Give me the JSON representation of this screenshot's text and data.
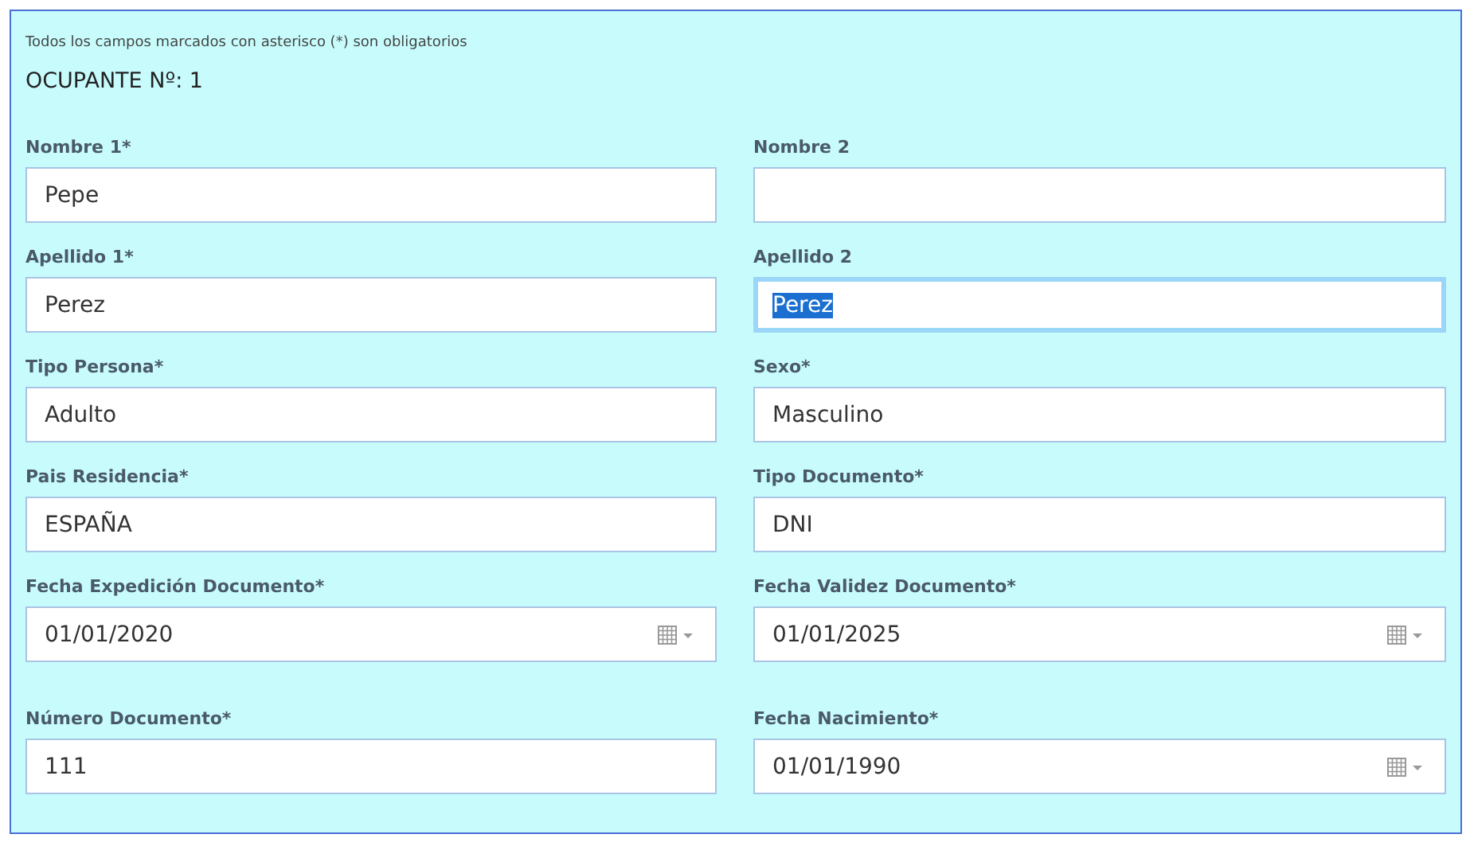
{
  "notice": "Todos los campos marcados con asterisco (*) son obligatorios",
  "heading": "OCUPANTE Nº: 1",
  "rows": [
    [
      {
        "label": "Nombre 1*",
        "kind": "text",
        "value": "Pepe",
        "focused": false
      },
      {
        "label": "Nombre 2",
        "kind": "text",
        "focused": false
      }
    ],
    [
      {
        "label": "Apellido 1*",
        "kind": "text",
        "value": "Perez",
        "focused": false
      },
      {
        "label": "Apellido 2",
        "kind": "text",
        "value": "Perez",
        "focused": true
      }
    ],
    [
      {
        "label": "Tipo Persona*",
        "kind": "text",
        "value": "Adulto",
        "focused": false
      },
      {
        "label": "Sexo*",
        "kind": "text",
        "value": "Masculino",
        "focused": false
      }
    ],
    [
      {
        "label": "Pais Residencia*",
        "kind": "text",
        "value": "ESPAÑA",
        "focused": false
      },
      {
        "label": "Tipo Documento*",
        "kind": "text",
        "value": "DNI",
        "focused": false
      }
    ],
    [
      {
        "label": "Fecha Expedición Documento*",
        "kind": "date",
        "value": "01/01/2020",
        "focused": false
      },
      {
        "label": "Fecha Validez Documento*",
        "kind": "date",
        "value": "01/01/2025",
        "focused": false
      }
    ],
    [
      {
        "label": "Número Documento*",
        "kind": "text",
        "value": "111",
        "focused": false
      },
      {
        "label": "Fecha Nacimiento*",
        "kind": "date",
        "value": "01/01/1990",
        "focused": false
      }
    ]
  ]
}
